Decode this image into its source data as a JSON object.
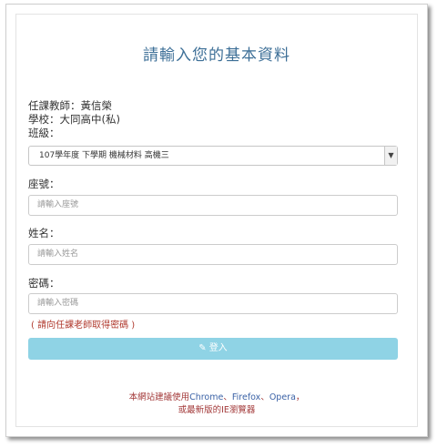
{
  "page": {
    "title": "請輸入您的基本資料"
  },
  "info": {
    "teacher": "任課教師：黃信榮",
    "school": "學校：大同高中(私)",
    "class_label": "班級："
  },
  "class_select": {
    "selected": "107學年度 下學期 機械材料 高機三",
    "arrow_icon": "chevron-down-icon"
  },
  "seat": {
    "label": "座號：",
    "placeholder": "請輸入座號"
  },
  "name": {
    "label": "姓名：",
    "placeholder": "請輸入姓名"
  },
  "password": {
    "label": "密碼：",
    "placeholder": "請輸入密碼",
    "hint": "( 請向任課老師取得密碼 )"
  },
  "login_button": {
    "icon": "edit-icon",
    "label": "登入",
    "color": "#8fd3e5"
  },
  "notice": {
    "prefix": "本網站建議使用",
    "chrome": "Chrome",
    "sep1": "、",
    "firefox": "Firefox",
    "sep2": "、",
    "opera": "Opera",
    "suffix": "，",
    "line2": "或最新版的IE瀏覽器"
  },
  "colors": {
    "title": "#3d6f97",
    "hint": "#b03a2e",
    "brand_link": "#3b62a6"
  }
}
